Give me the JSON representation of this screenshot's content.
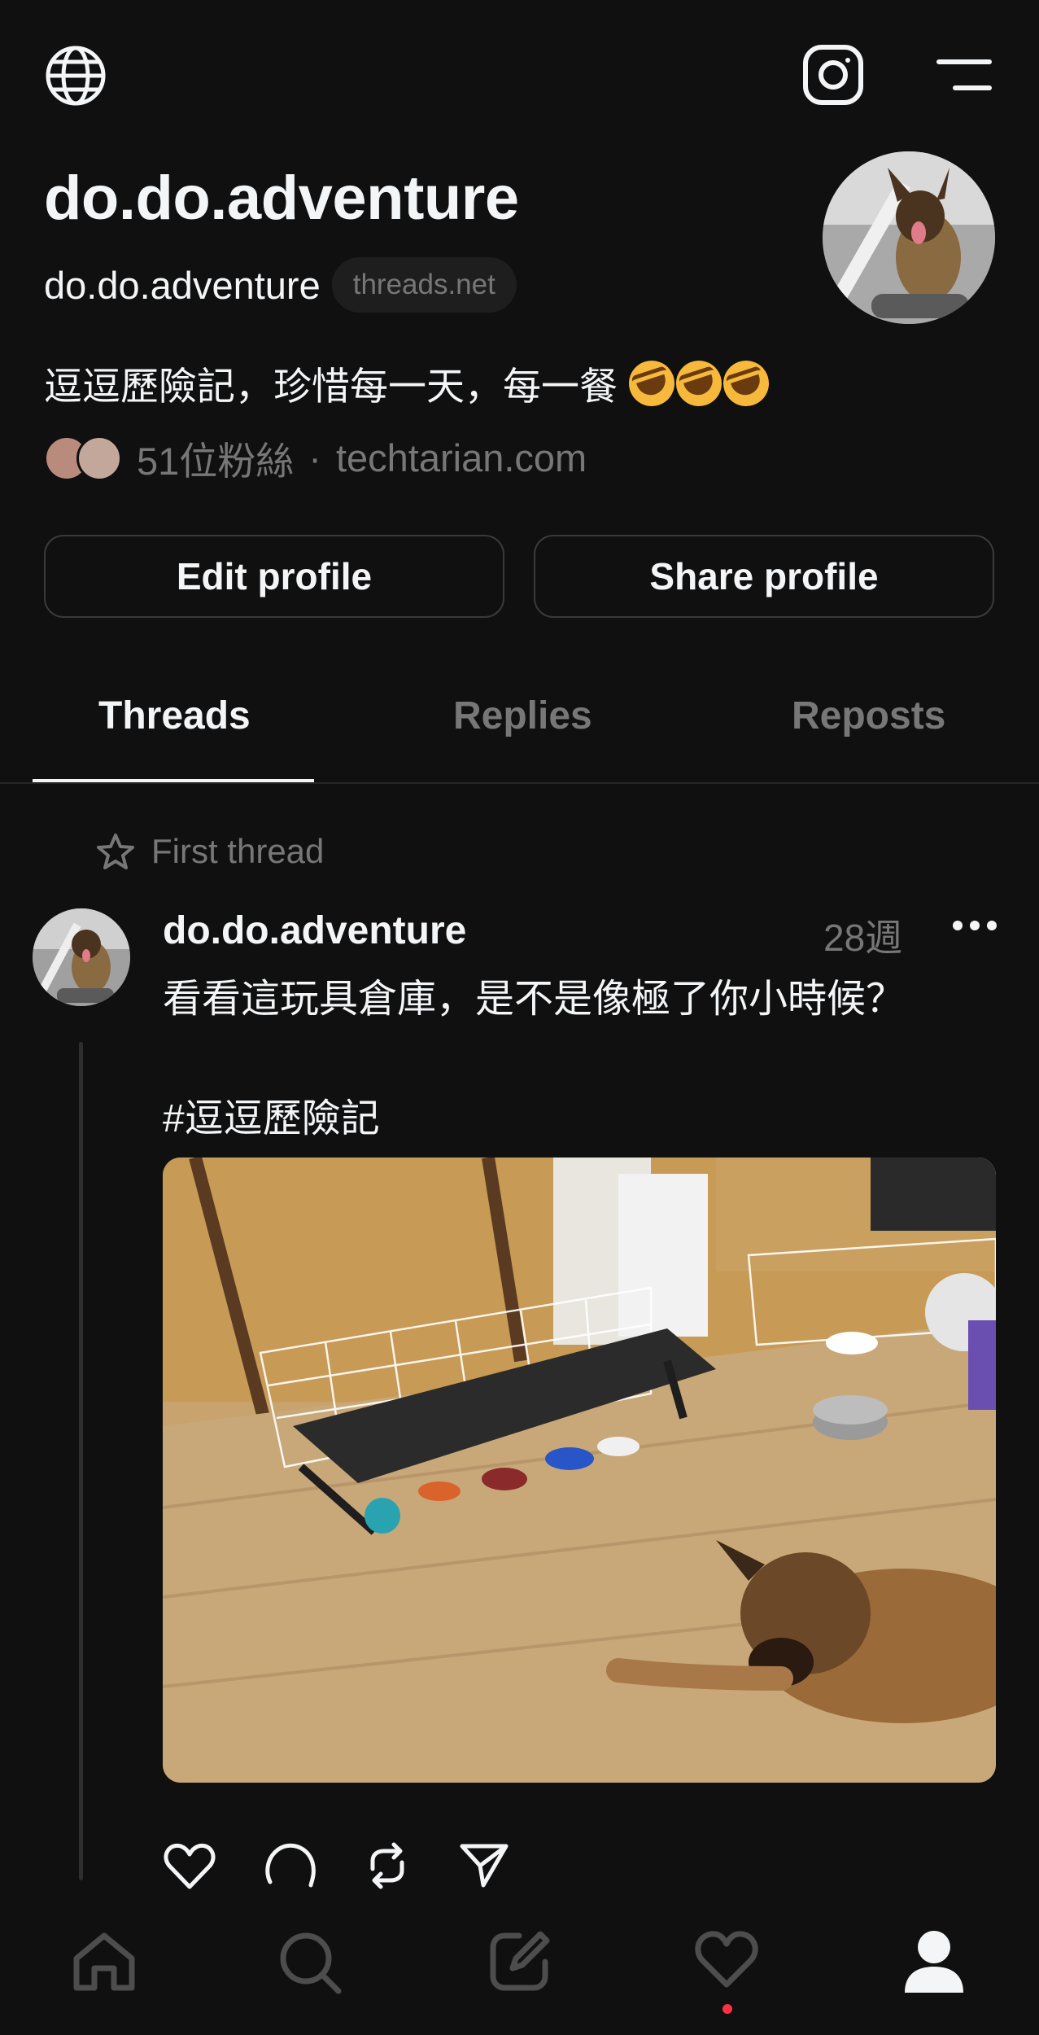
{
  "top_bar": {
    "language_icon": "globe-icon",
    "instagram_icon": "instagram-icon",
    "menu_icon": "menu-icon"
  },
  "profile": {
    "display_name": "do.do.adventure",
    "username": "do.do.adventure",
    "domain_badge": "threads.net",
    "bio": "逗逗歷險記，珍惜每一天，每一餐",
    "bio_emoji": "rolling-on-floor-laughing x3",
    "followers": "51位粉絲",
    "separator": "·",
    "link": "techtarian.com"
  },
  "buttons": {
    "edit": "Edit profile",
    "share": "Share profile"
  },
  "tabs": [
    {
      "label": "Threads",
      "active": true
    },
    {
      "label": "Replies",
      "active": false
    },
    {
      "label": "Reposts",
      "active": false
    }
  ],
  "post": {
    "pinned_label": "First thread",
    "username": "do.do.adventure",
    "time": "28週",
    "text": "看看這玩具倉庫，是不是像極了你小時候？",
    "hashtag": "#逗逗歷險記",
    "image_alt": "dog lying on wooden floor near a pet cot full of toys"
  },
  "bottom_nav": {
    "home": "home-icon",
    "search": "search-icon",
    "compose": "compose-icon",
    "activity": "heart-icon",
    "profile": "profile-icon"
  },
  "colors": {
    "background": "#101010",
    "text": "#f3f5f7",
    "muted": "#777777",
    "notification": "#ff3040"
  }
}
